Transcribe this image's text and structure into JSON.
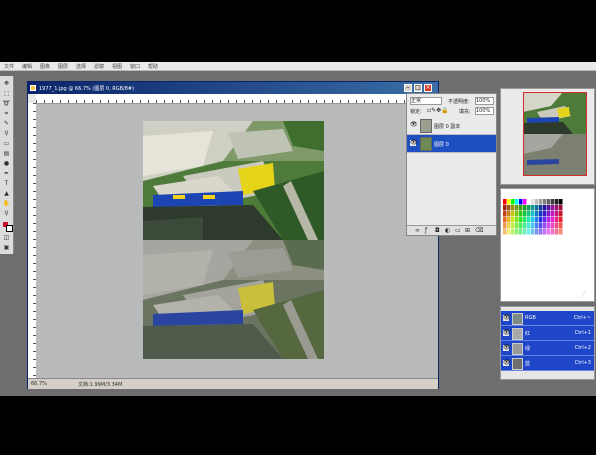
{
  "menubar": {
    "items": [
      "文件",
      "编辑",
      "图像",
      "图层",
      "选择",
      "滤镜",
      "视图",
      "窗口",
      "帮助"
    ]
  },
  "document": {
    "title": "1977_1.jpg @ 66.7% (图层 0, RGB/8#)",
    "zoom": "66.7%",
    "doc_info": "文档:1.99M/3.34M"
  },
  "layers_panel": {
    "blend_mode": "正常",
    "opacity_label": "不透明度:",
    "opacity_value": "100%",
    "lock_label": "锁定:",
    "fill_label": "填充:",
    "fill_value": "100%",
    "layers": [
      {
        "name": "图层 0 副本",
        "selected": false,
        "visible": true
      },
      {
        "name": "图层 0",
        "selected": true,
        "visible": true
      }
    ]
  },
  "channels_panel": {
    "channels": [
      {
        "name": "RGB",
        "shortcut": "Ctrl+~",
        "thumb_color": "#7c8a86"
      },
      {
        "name": "红",
        "shortcut": "Ctrl+1",
        "thumb_color": "#a9a9a9"
      },
      {
        "name": "绿",
        "shortcut": "Ctrl+2",
        "thumb_color": "#9a9a9a"
      },
      {
        "name": "蓝",
        "shortcut": "Ctrl+3",
        "thumb_color": "#6d6d6d"
      }
    ]
  },
  "colors": {
    "title_bar": "#0a246a",
    "selection": "#1e4fc0",
    "canvas_bg": "#b9bbba",
    "workspace_bg": "#6e6e6e"
  }
}
